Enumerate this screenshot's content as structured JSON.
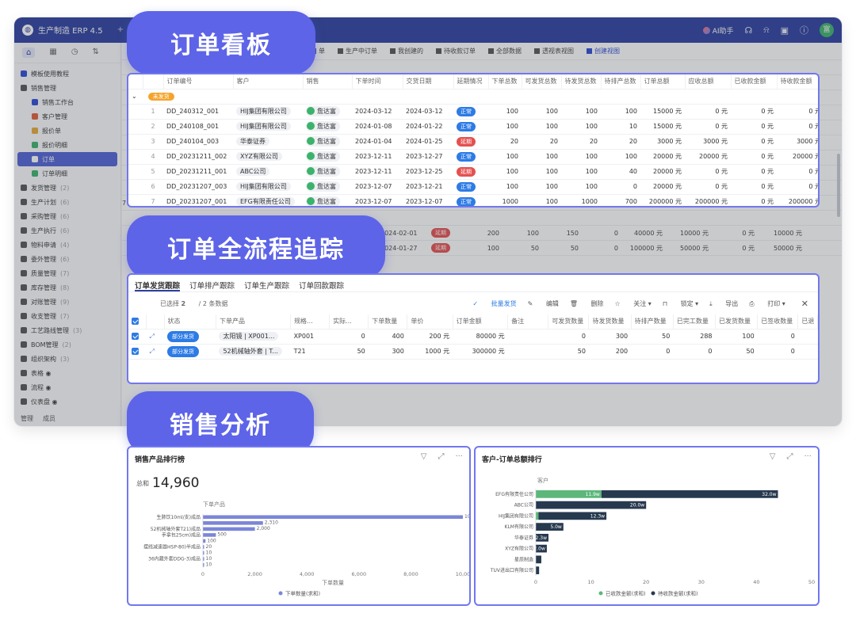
{
  "app": {
    "title": "生产制造 ERP 4.5",
    "add_label": "+",
    "ai_label": "AI助手",
    "user_initial": "富"
  },
  "sidebar": {
    "items": [
      {
        "label": "模板使用教程",
        "count": "",
        "sub": false,
        "color": "#2c4bd6"
      },
      {
        "label": "销售管理",
        "count": "",
        "sub": false,
        "color": "#555"
      },
      {
        "label": "销售工作台",
        "count": "",
        "sub": true,
        "color": "#2c4bd6"
      },
      {
        "label": "客户管理",
        "count": "",
        "sub": true,
        "color": "#e0603a"
      },
      {
        "label": "报价单",
        "count": "",
        "sub": true,
        "color": "#e8a93a"
      },
      {
        "label": "报价明细",
        "count": "",
        "sub": true,
        "color": "#3bb36b"
      },
      {
        "label": "订单",
        "count": "",
        "sub": true,
        "color": "#fff",
        "active": true
      },
      {
        "label": "订单明细",
        "count": "",
        "sub": true,
        "color": "#3bb36b"
      },
      {
        "label": "发货管理",
        "count": "(2)",
        "sub": false,
        "color": "#555"
      },
      {
        "label": "生产计划",
        "count": "(6)",
        "sub": false,
        "color": "#555"
      },
      {
        "label": "采购管理",
        "count": "(6)",
        "sub": false,
        "color": "#555"
      },
      {
        "label": "生产执行",
        "count": "(6)",
        "sub": false,
        "color": "#555"
      },
      {
        "label": "物料申请",
        "count": "(4)",
        "sub": false,
        "color": "#555"
      },
      {
        "label": "委外管理",
        "count": "(6)",
        "sub": false,
        "color": "#555"
      },
      {
        "label": "质量管理",
        "count": "(7)",
        "sub": false,
        "color": "#555"
      },
      {
        "label": "库存管理",
        "count": "(8)",
        "sub": false,
        "color": "#555"
      },
      {
        "label": "对账管理",
        "count": "(9)",
        "sub": false,
        "color": "#555"
      },
      {
        "label": "收支管理",
        "count": "(7)",
        "sub": false,
        "color": "#555"
      },
      {
        "label": "工艺路线管理",
        "count": "(3)",
        "sub": false,
        "color": "#555"
      },
      {
        "label": "BOM管理",
        "count": "(2)",
        "sub": false,
        "color": "#555"
      },
      {
        "label": "组织架构",
        "count": "(3)",
        "sub": false,
        "color": "#555"
      },
      {
        "label": "表格 ◉",
        "count": "",
        "sub": false,
        "color": "#555"
      },
      {
        "label": "流程 ◉",
        "count": "",
        "sub": false,
        "color": "#555"
      },
      {
        "label": "仪表盘 ◉",
        "count": "",
        "sub": false,
        "color": "#555"
      }
    ],
    "footer": [
      "管理",
      "成员"
    ]
  },
  "view_tabs": [
    {
      "label": "单",
      "new": false
    },
    {
      "label": "生产中订单",
      "new": false
    },
    {
      "label": "我创建的",
      "new": false
    },
    {
      "label": "待收款订单",
      "new": false
    },
    {
      "label": "全部数据",
      "new": false
    },
    {
      "label": "透视表视图",
      "new": false
    },
    {
      "label": "创建视图",
      "new": true
    }
  ],
  "callouts": {
    "board": "订单看板",
    "trace": "订单全流程追踪",
    "analysis": "销售分析"
  },
  "orders": {
    "headers": [
      "订单编号",
      "客户",
      "销售",
      "下单时间",
      "交货日期",
      "延期情况",
      "下单总数",
      "可发货总数",
      "待发货总数",
      "待排产总数",
      "订单总额",
      "应收总额",
      "已收款金额",
      "待收款金额"
    ],
    "group_label": "未发货",
    "rows": [
      {
        "n": "1",
        "id": "DD_240312_001",
        "customer": "HIJ集团有限公司",
        "sales": "詹达富",
        "order_date": "2024-03-12",
        "delivery": "2024-03-12",
        "status": "正常",
        "late": false,
        "qty": "100",
        "can_ship": "100",
        "to_ship": "100",
        "to_plan": "100",
        "total": "15000 元",
        "receivable": "0 元",
        "received": "0 元",
        "pending": "0 元"
      },
      {
        "n": "2",
        "id": "DD_240108_001",
        "customer": "HIJ集团有限公司",
        "sales": "詹达富",
        "order_date": "2024-01-08",
        "delivery": "2024-01-22",
        "status": "正常",
        "late": false,
        "qty": "100",
        "can_ship": "100",
        "to_ship": "100",
        "to_plan": "10",
        "total": "15000 元",
        "receivable": "0 元",
        "received": "0 元",
        "pending": "0 元"
      },
      {
        "n": "3",
        "id": "DD_240104_003",
        "customer": "华泰证券",
        "sales": "詹达富",
        "order_date": "2024-01-04",
        "delivery": "2024-01-25",
        "status": "延期",
        "late": true,
        "qty": "20",
        "can_ship": "20",
        "to_ship": "20",
        "to_plan": "20",
        "total": "3000 元",
        "receivable": "3000 元",
        "received": "0 元",
        "pending": "3000 元"
      },
      {
        "n": "4",
        "id": "DD_20231211_002",
        "customer": "XYZ有限公司",
        "sales": "詹达富",
        "order_date": "2023-12-11",
        "delivery": "2023-12-27",
        "status": "正常",
        "late": false,
        "qty": "100",
        "can_ship": "100",
        "to_ship": "100",
        "to_plan": "100",
        "total": "20000 元",
        "receivable": "20000 元",
        "received": "0 元",
        "pending": "20000 元"
      },
      {
        "n": "5",
        "id": "DD_20231211_001",
        "customer": "ABC公司",
        "sales": "詹达富",
        "order_date": "2023-12-11",
        "delivery": "2023-12-25",
        "status": "延期",
        "late": true,
        "qty": "100",
        "can_ship": "100",
        "to_ship": "100",
        "to_plan": "40",
        "total": "20000 元",
        "receivable": "0 元",
        "received": "0 元",
        "pending": "0 元"
      },
      {
        "n": "6",
        "id": "DD_20231207_003",
        "customer": "HIJ集团有限公司",
        "sales": "詹达富",
        "order_date": "2023-12-07",
        "delivery": "2023-12-21",
        "status": "正常",
        "late": false,
        "qty": "100",
        "can_ship": "100",
        "to_ship": "100",
        "to_plan": "0",
        "total": "20000 元",
        "receivable": "0 元",
        "received": "0 元",
        "pending": "0 元"
      },
      {
        "n": "7",
        "id": "DD_20231207_001",
        "customer": "EFG有限责任公司",
        "sales": "詹达富",
        "order_date": "2023-12-07",
        "delivery": "2023-12-07",
        "status": "正常",
        "late": false,
        "qty": "1000",
        "can_ship": "100",
        "to_ship": "1000",
        "to_plan": "700",
        "total": "200000 元",
        "receivable": "200000 元",
        "received": "0 元",
        "pending": "200000 元"
      }
    ]
  },
  "background_rows": [
    {
      "n": "7",
      "id": "DD_20231207_001",
      "customer": "EFG有限责任公司",
      "sales": "詹达富",
      "order_date": "2023-12-07",
      "delivery": "2023-12-07",
      "status": "正常",
      "late": false,
      "qty": "1000",
      "can_ship": "100",
      "to_ship": "1000",
      "to_plan": "700",
      "total": "200000 元",
      "receivable": "200000 元",
      "received": "0 元",
      "pending": "200000 元"
    },
    {
      "id_tail": "04",
      "delivery": "2024-02-01",
      "status": "延期",
      "late": true,
      "qty": "200",
      "can_ship": "100",
      "to_ship": "150",
      "to_plan": "0",
      "total": "40000 元",
      "receivable": "10000 元",
      "received": "0 元",
      "pending": "10000 元"
    },
    {
      "id_tail": "04",
      "delivery": "2024-01-27",
      "status": "延期",
      "late": true,
      "qty": "100",
      "can_ship": "50",
      "to_ship": "50",
      "to_plan": "0",
      "total": "100000 元",
      "receivable": "50000 元",
      "received": "0 元",
      "pending": "50000 元"
    }
  ],
  "trace": {
    "tabs": [
      "订单发货跟踪",
      "订单排产跟踪",
      "订单生产跟踪",
      "订单回款跟踪"
    ],
    "selected_prefix": "已选择",
    "selected_count": "2",
    "selected_suffix": "/ 2 条数据",
    "actions": [
      "批量发货",
      "编辑",
      "删除",
      "关注",
      "锁定",
      "导出",
      "打印"
    ],
    "headers": [
      "状态",
      "下单产品",
      "规格...",
      "实际...",
      "下单数量",
      "单价",
      "订单金额",
      "备注",
      "可发货数量",
      "待发货数量",
      "待排产数量",
      "已完工数量",
      "已发货数量",
      "已签收数量",
      "已退"
    ],
    "rows": [
      {
        "status": "部分发货",
        "product": "太阳镜 | XP001...",
        "spec": "XP001",
        "actual": "0",
        "qty": "400",
        "price": "200 元",
        "amount": "80000 元",
        "note": "",
        "can_ship": "0",
        "to_ship": "300",
        "to_plan": "50",
        "done": "288",
        "shipped": "100",
        "signed": "0",
        "returned": ""
      },
      {
        "status": "部分发货",
        "product": "52机械轴外套 | T...",
        "spec": "T21",
        "actual": "50",
        "qty": "300",
        "price": "1000 元",
        "amount": "300000 元",
        "note": "",
        "can_ship": "50",
        "to_ship": "200",
        "to_plan": "0",
        "done": "0",
        "shipped": "50",
        "signed": "0",
        "returned": ""
      }
    ]
  },
  "chart_data": [
    {
      "type": "bar",
      "orientation": "horizontal",
      "title": "销售产品排行榜",
      "total_label": "总和",
      "total_value": "14,960",
      "ylabel": "下单产品",
      "xlabel": "下单数量",
      "categories": [
        "生肺饮10ml/支)成品",
        "52机械轴外套T21)成品",
        "手拿包25cm)成品",
        "摆线减速器HSP-80)半成品",
        "36内藏外套DDG-3)成品"
      ],
      "series": [
        {
          "name": "下单数量(求和)",
          "values": [
            10000,
            2310,
            2000,
            500,
            100,
            20,
            10,
            10,
            10
          ]
        }
      ],
      "bar_labels": [
        "10",
        "2,310",
        "2,000",
        "500",
        "100",
        "20",
        "10",
        "10",
        "10"
      ],
      "xlim": [
        0,
        10000
      ],
      "xticks": [
        "0",
        "2,000",
        "4,000",
        "6,000",
        "8,000",
        "10,00"
      ],
      "legend": "bottom",
      "color": "#7a86d8"
    },
    {
      "type": "bar",
      "orientation": "horizontal",
      "stacked": true,
      "title": "客户-订单总额排行",
      "ylabel": "客户",
      "categories": [
        "EFG有限责任公司",
        "ABC公司",
        "HIJ集团有限公司",
        "KLM有限公司",
        "华泰证券",
        "XYZ有限公司",
        "星辰制造",
        "TUV进出口有限公司"
      ],
      "series": [
        {
          "name": "已收款金额(求和)",
          "values": [
            11.9,
            0,
            0.5,
            0,
            0,
            0,
            0,
            0
          ],
          "labels": [
            "11.9w",
            "",
            "",
            "",
            "",
            "",
            "",
            ""
          ],
          "color": "#5cb87a"
        },
        {
          "name": "待收款金额(求和)",
          "values": [
            32.0,
            20.0,
            12.3,
            5.0,
            2.3,
            2.0,
            1.0,
            0.6
          ],
          "labels": [
            "32.0w",
            "20.0w",
            "12.3w",
            "5.0w",
            "2.3w",
            "2.0w",
            "",
            ""
          ],
          "color": "#27394f"
        }
      ],
      "xlim": [
        0,
        50
      ],
      "xticks": [
        "0",
        "10",
        "20",
        "30",
        "40",
        "50"
      ],
      "legend": "bottom"
    }
  ]
}
